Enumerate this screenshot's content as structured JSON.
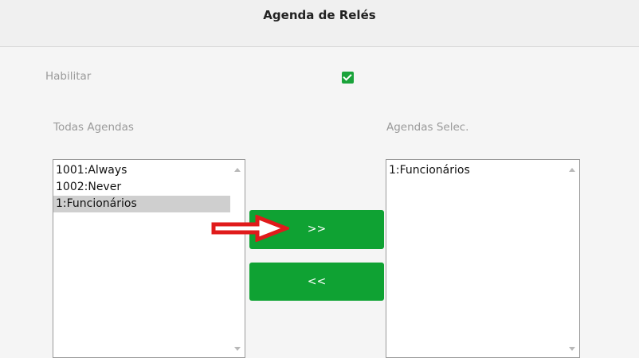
{
  "header": {
    "title": "Agenda de Relés"
  },
  "enable": {
    "label": "Habilitar",
    "checked": true
  },
  "all_schedules": {
    "label": "Todas Agendas",
    "items": [
      {
        "text": "1001:Always",
        "selected": false
      },
      {
        "text": "1002:Never",
        "selected": false
      },
      {
        "text": "1:Funcionários",
        "selected": true
      }
    ]
  },
  "selected_schedules": {
    "label": "Agendas Selec.",
    "items": [
      {
        "text": "1:Funcionários",
        "selected": false
      }
    ]
  },
  "buttons": {
    "add_label": ">>",
    "remove_label": "<<"
  },
  "colors": {
    "accent_green": "#0fa233",
    "annotation_red": "#e01b1b"
  },
  "annotation": {
    "icon": "red-arrow-icon"
  }
}
